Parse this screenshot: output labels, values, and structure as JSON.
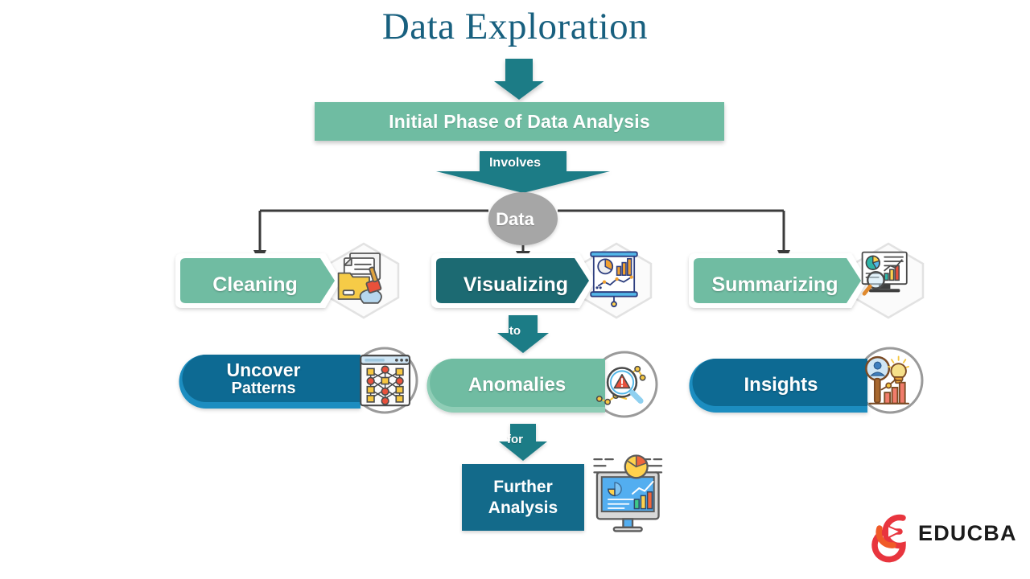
{
  "page": {
    "title": "Data Exploration",
    "background": "#ffffff"
  },
  "colors": {
    "title": "#18607f",
    "teal_light": "#6fbca2",
    "teal_dark": "#1c6b72",
    "blue": "#0b6b93",
    "blue_dark": "#136a8a",
    "gray_node": "#a6a6a6",
    "arrow_teal": "#1c7b86",
    "connector": "#3b3b3b",
    "hex_fill": "#fbfbfb",
    "hex_stroke": "#d9d9d9",
    "circle_stroke": "#9a9a9a",
    "logo_red": "#e8353e",
    "logo_orange": "#f05a28",
    "logo_text": "#1b1b1b"
  },
  "phase": {
    "label": "Initial Phase of Data Analysis"
  },
  "connectors": {
    "involves_label": "Involves",
    "to_label": "to",
    "for_label": "for"
  },
  "data_node": {
    "label": "Data"
  },
  "row1": [
    {
      "label": "Cleaning",
      "fill": "#6fbca2",
      "icon": "folder-documents-brush-icon"
    },
    {
      "label": "Visualizing",
      "fill": "#1c6b72",
      "icon": "presentation-chart-icon"
    },
    {
      "label": "Summarizing",
      "fill": "#6fbca2",
      "icon": "report-magnifier-icon"
    }
  ],
  "row2": [
    {
      "label": "Uncover",
      "sublabel": "Patterns",
      "fill": "#0b6b93",
      "icon": "network-pattern-window-icon"
    },
    {
      "label": "Anomalies",
      "sublabel": "",
      "fill": "#6fbca2",
      "icon": "magnifier-warning-icon"
    },
    {
      "label": "Insights",
      "sublabel": "",
      "fill": "#0b6b93",
      "icon": "magnifier-person-bulb-chart-icon"
    }
  ],
  "final": {
    "line1": "Further",
    "line2": "Analysis",
    "icon": "monitor-dashboard-icon"
  },
  "logo": {
    "text": "EDUCBA",
    "mark": "educba-e-play-icon"
  }
}
